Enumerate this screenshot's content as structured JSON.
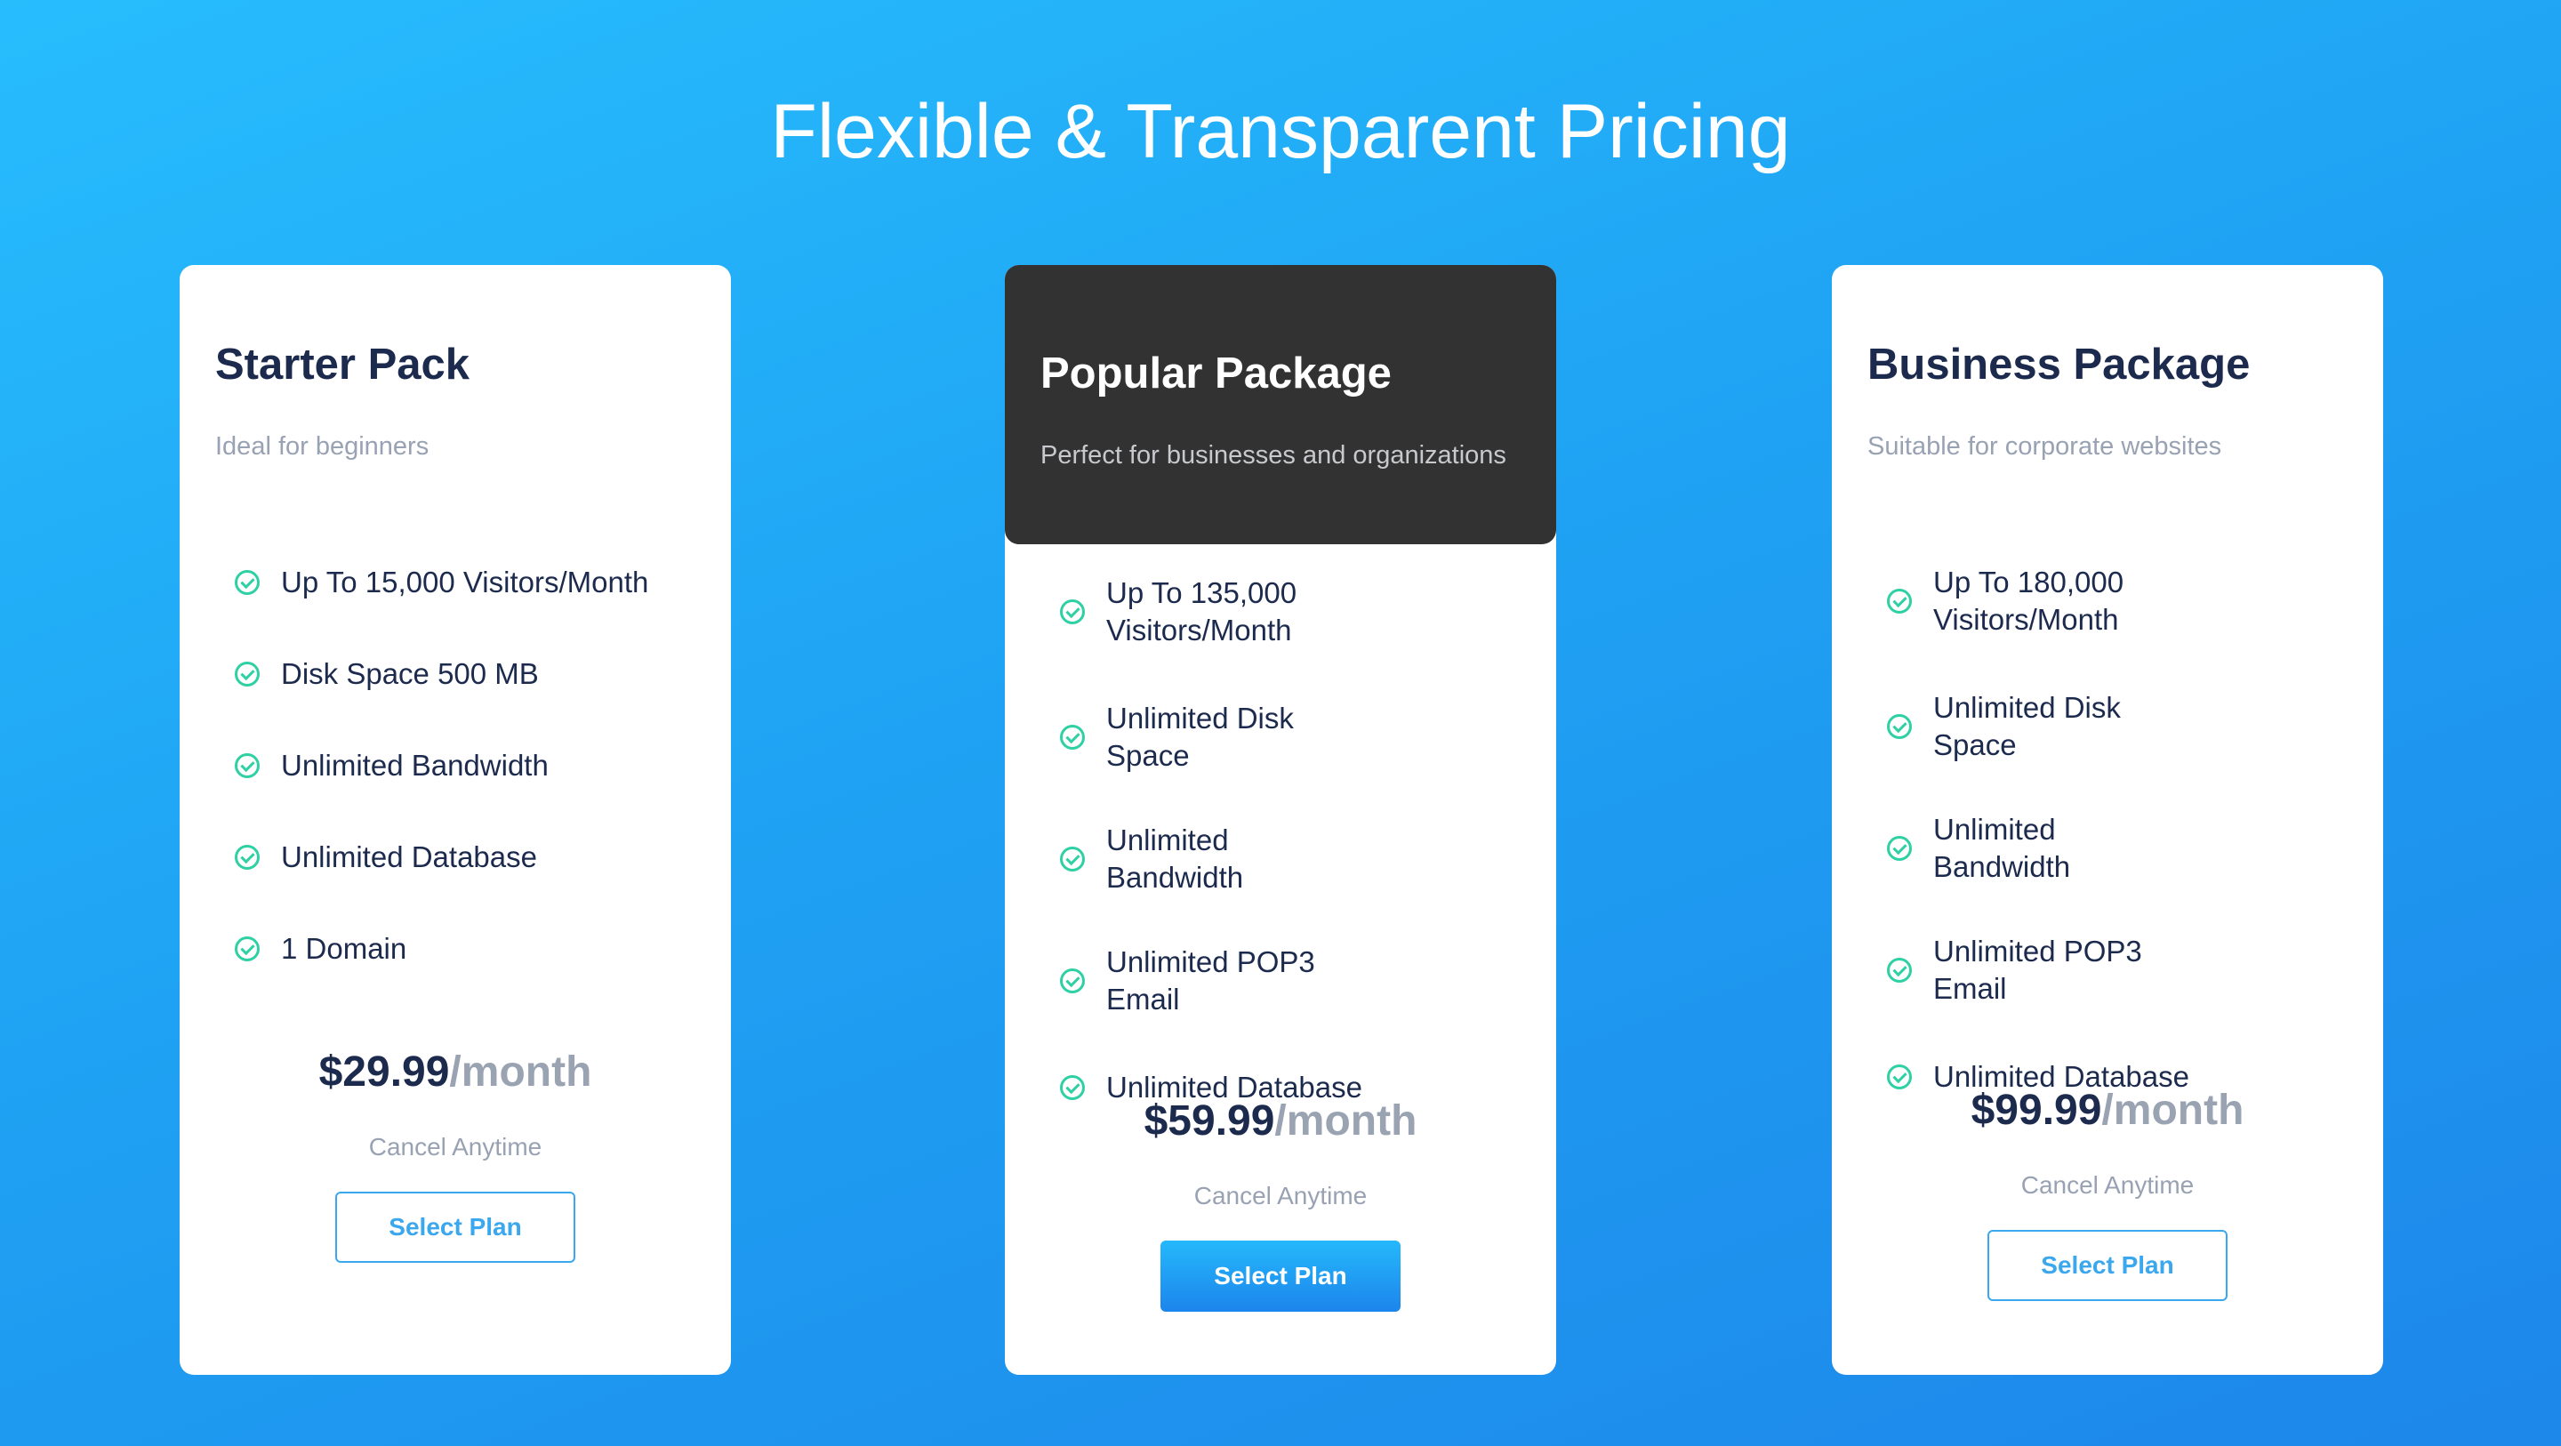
{
  "page": {
    "title": "Flexible & Transparent Pricing"
  },
  "colors": {
    "accent": "#1fa2f3",
    "check": "#2fd0a4",
    "heading": "#1c2a4d",
    "popular_header": "#323232"
  },
  "icons": {
    "feature": "check-circle-icon"
  },
  "plans": [
    {
      "name": "Starter Pack",
      "description": "Ideal for beginners",
      "features": [
        "Up To 15,000 Visitors/Month",
        "Disk Space 500 MB",
        "Unlimited Bandwidth",
        "Unlimited Database",
        "1 Domain"
      ],
      "price": "$29.99",
      "period": "/month",
      "note": "Cancel Anytime",
      "button": "Select Plan"
    },
    {
      "name": "Popular Package",
      "description": "Perfect for businesses and organizations",
      "features": [
        "Up To 135,000 Visitors/Month",
        "Unlimited Disk Space",
        "Unlimited Bandwidth",
        "Unlimited POP3 Email",
        "Unlimited Database"
      ],
      "price": "$59.99",
      "period": "/month",
      "note": "Cancel Anytime",
      "button": "Select Plan"
    },
    {
      "name": "Business Package",
      "description": "Suitable for corporate websites",
      "features": [
        "Up To 180,000 Visitors/Month",
        "Unlimited Disk Space",
        "Unlimited Bandwidth",
        "Unlimited POP3 Email",
        "Unlimited Database"
      ],
      "price": "$99.99",
      "period": "/month",
      "note": "Cancel Anytime",
      "button": "Select Plan"
    }
  ]
}
